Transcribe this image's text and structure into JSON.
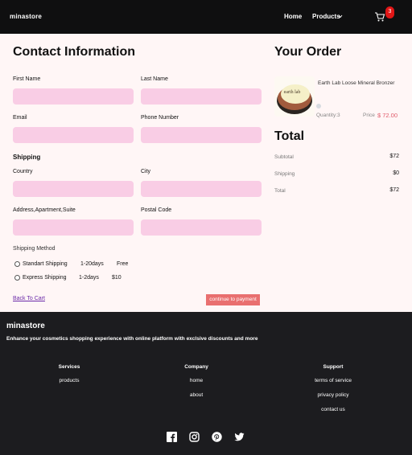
{
  "nav": {
    "brand": "minastore",
    "home": "Home",
    "products": "Products",
    "cart_count": "3"
  },
  "contact": {
    "title": "Contact Information",
    "first_name_label": "First Name",
    "last_name_label": "Last Name",
    "email_label": "Email",
    "phone_label": "Phone Number",
    "shipping_title": "Shipping",
    "country_label": "Country",
    "city_label": "City",
    "address_label": "Address,Apartment,Suite",
    "postal_label": "Postal Code",
    "shipping_method_label": "Shipping Method",
    "methods": [
      {
        "name": "Standart Shipping",
        "days": "1-20days",
        "price": "Free"
      },
      {
        "name": "Express Shipping",
        "days": "1-2days",
        "price": "$10"
      }
    ],
    "back_link": "Back To Cart",
    "continue_button": "continue to payment"
  },
  "order": {
    "title": "Your Order",
    "product_name": "Earth Lab Loose Mineral Bronzer",
    "product_image_text": "earth lab",
    "quantity": "Quantity:3",
    "price_label": "Price",
    "price_value": "$ 72.00",
    "total_title": "Total",
    "subtotal_label": "Subtotal",
    "subtotal_value": "$72",
    "shipping_label": "Shipping",
    "shipping_value": "$0",
    "total_label": "Total",
    "total_value": "$72"
  },
  "footer": {
    "brand": "minastore",
    "tagline": "Enhance your cosmetics shopping experience with online platform with exclsive discounts and more",
    "services": {
      "heading": "Services",
      "links": [
        "products"
      ]
    },
    "company": {
      "heading": "Company",
      "links": [
        "home",
        "about"
      ]
    },
    "support": {
      "heading": "Support",
      "links": [
        "terms of service",
        "privacy policy",
        "contact us"
      ]
    },
    "social_icons": [
      "facebook-icon",
      "instagram-icon",
      "pinterest-icon",
      "twitter-icon"
    ]
  },
  "colors": {
    "field_bg": "#f9cde5",
    "page_bg": "#fff6f6",
    "accent_button": "#e96f6f",
    "badge": "#e01616",
    "price": "#e05a6a"
  }
}
